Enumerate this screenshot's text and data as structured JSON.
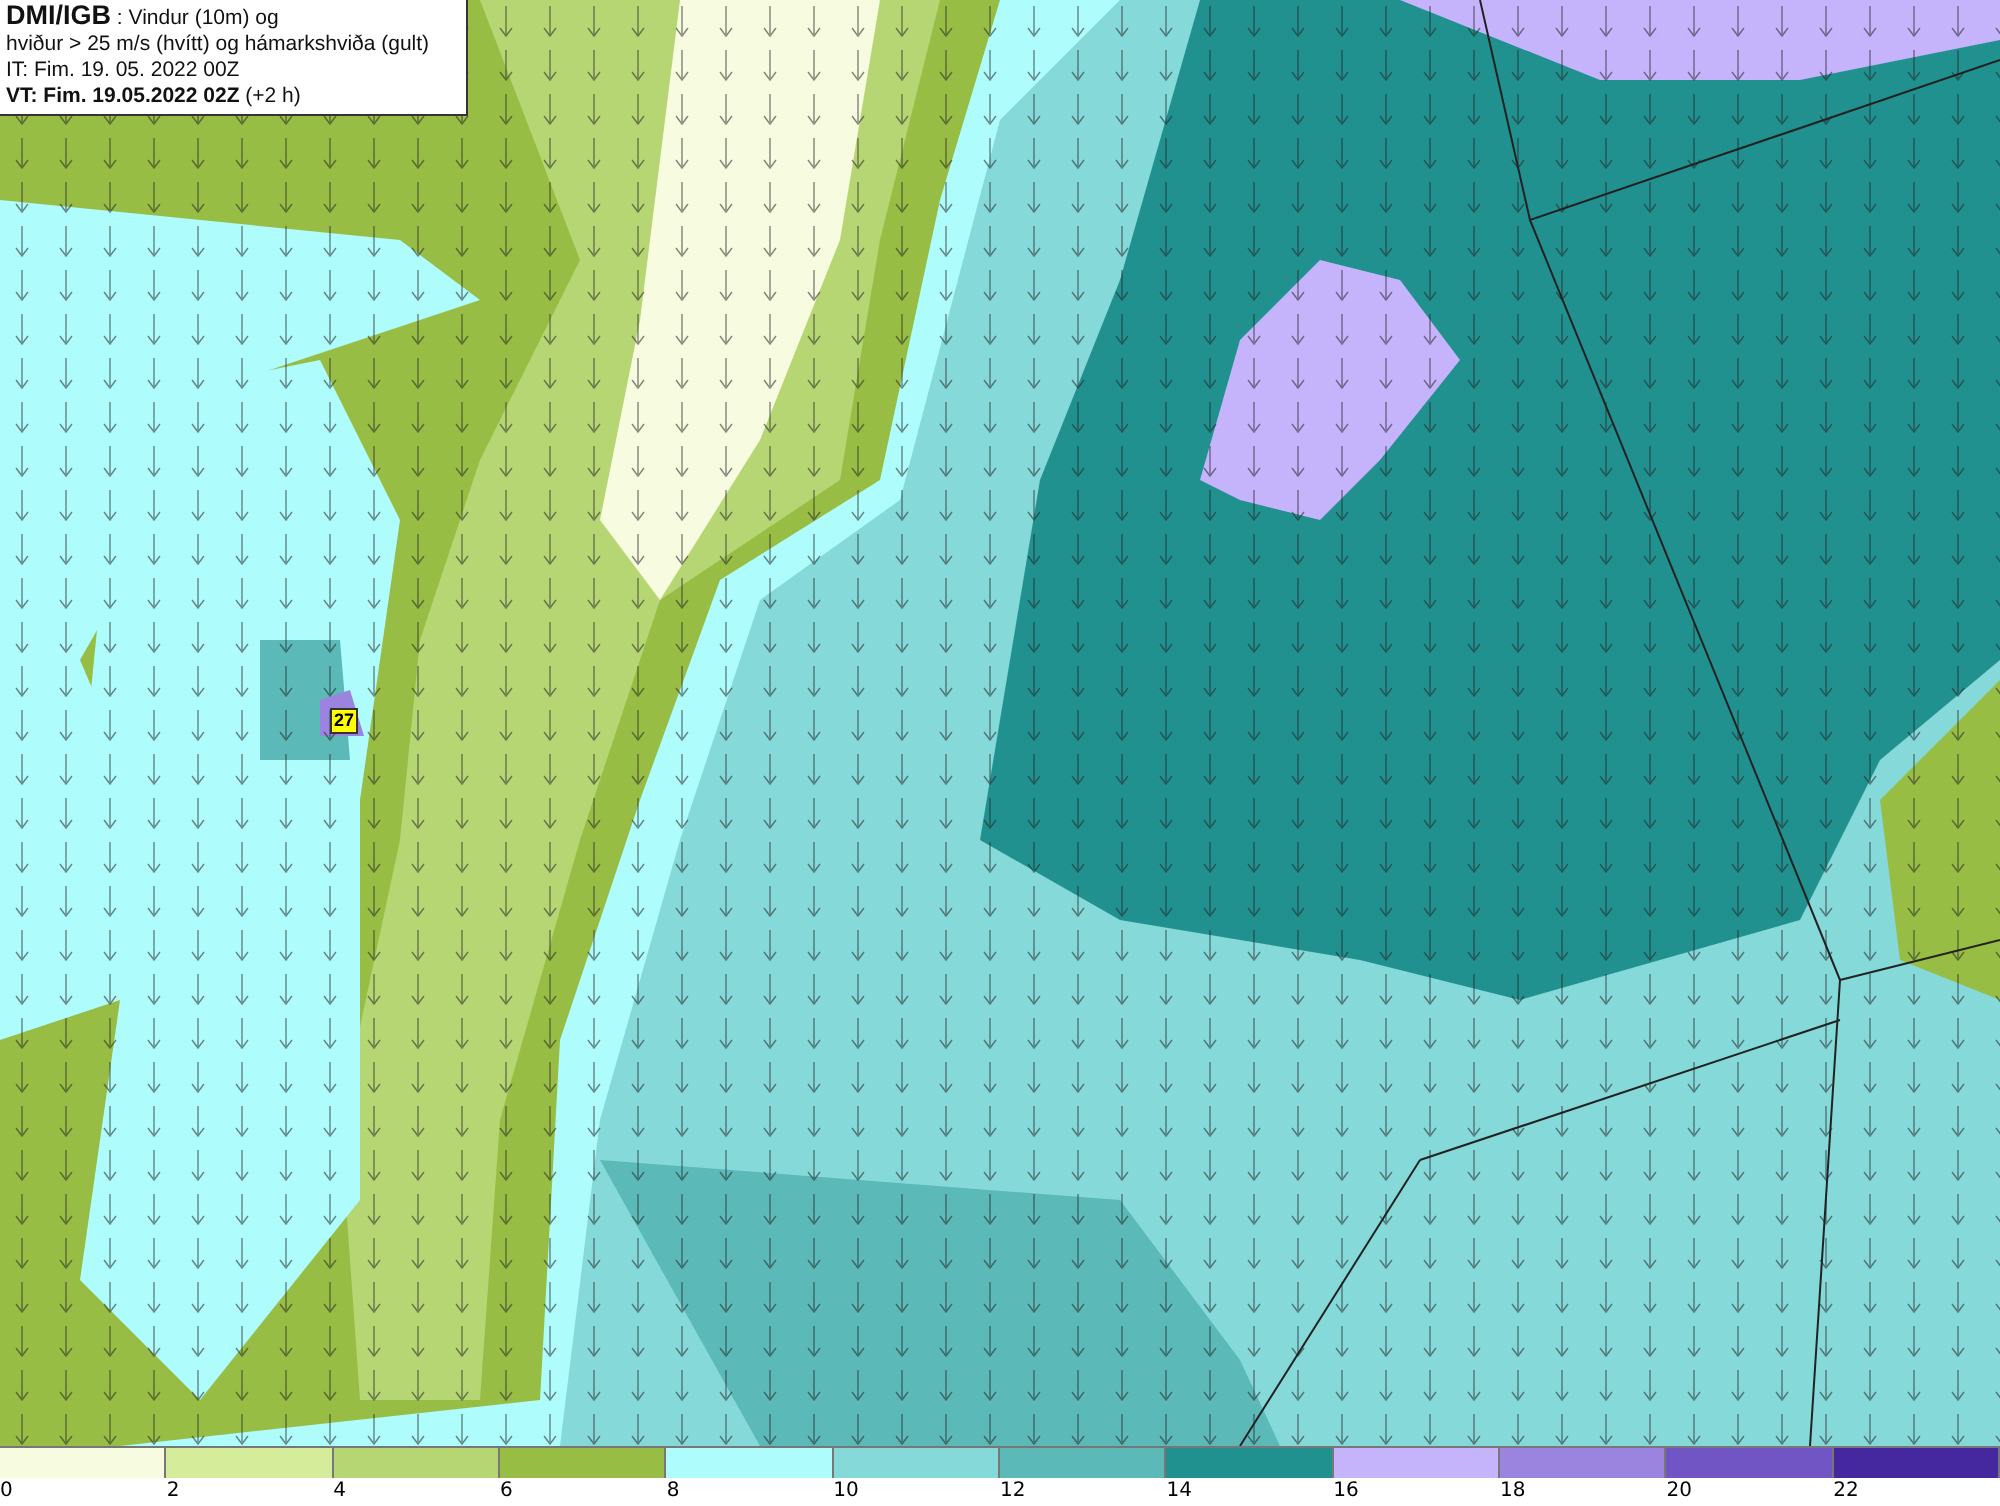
{
  "header": {
    "title": "**DMI/IGB** : Vindur (10m) og",
    "subtitle": "hviður > 25 m/s (hvítt) og hámarkshviða (gult)",
    "issue_time": "IT: Fim. 19. 05. 2022 00Z",
    "valid_time": "**VT: Fim. 19.05.2022 02Z** (+2 h)"
  },
  "map": {
    "gust_label": "27"
  },
  "legend": [
    {
      "label": "0",
      "color": "#f7fbdf"
    },
    {
      "label": "2",
      "color": "#d5ec9a"
    },
    {
      "label": "4",
      "color": "#b5d672"
    },
    {
      "label": "6",
      "color": "#97bd45"
    },
    {
      "label": "8",
      "color": "#aefcfc"
    },
    {
      "label": "10",
      "color": "#85d9d9"
    },
    {
      "label": "12",
      "color": "#5bb9b8"
    },
    {
      "label": "14",
      "color": "#21918f"
    },
    {
      "label": "16",
      "color": "#c5b4fb"
    },
    {
      "label": "18",
      "color": "#9a84e0"
    },
    {
      "label": "20",
      "color": "#7155c4"
    },
    {
      "label": "22",
      "color": "#4527a0"
    }
  ]
}
